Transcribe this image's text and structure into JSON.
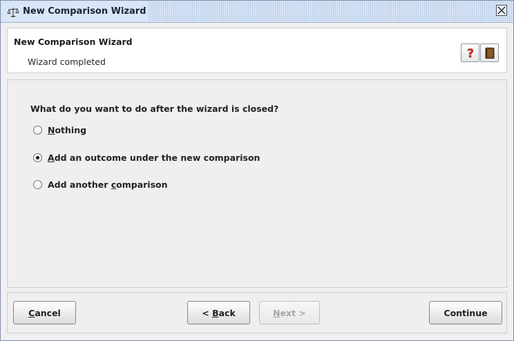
{
  "window": {
    "title": "New Comparison Wizard",
    "close_glyph": "☒"
  },
  "header": {
    "title": "New Comparison Wizard",
    "subtitle": "Wizard completed",
    "help_icon": "help-icon",
    "book_icon": "book-icon"
  },
  "content": {
    "question": "What do you want to do after the wizard is closed?",
    "options": [
      {
        "mnemonic": "N",
        "rest": "othing",
        "prefix": "",
        "selected": false
      },
      {
        "mnemonic": "A",
        "rest": "dd an outcome under the new comparison",
        "prefix": "",
        "selected": true
      },
      {
        "mnemonic": "c",
        "rest": "omparison",
        "prefix": "Add another ",
        "selected": false
      }
    ]
  },
  "footer": {
    "cancel": {
      "mnemonic": "C",
      "rest": "ancel"
    },
    "back": {
      "prefix": "< ",
      "mnemonic": "B",
      "rest": "ack"
    },
    "next": {
      "mnemonic": "N",
      "rest": "ext >",
      "enabled": false
    },
    "continue": "Continue"
  },
  "colors": {
    "titlebar": "#d9e6f7",
    "help_icon_red": "#d42a1e",
    "book_brown": "#8a5a23"
  }
}
